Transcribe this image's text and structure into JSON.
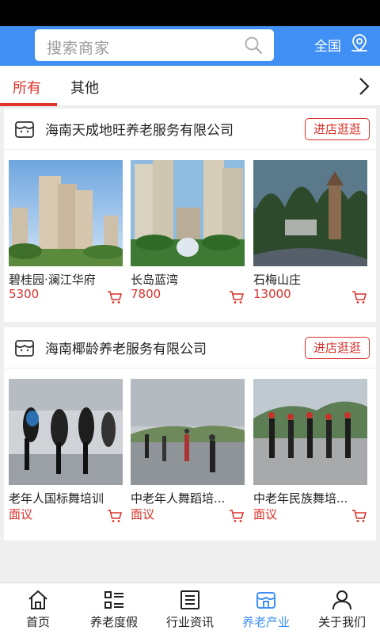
{
  "search": {
    "placeholder": "搜索商家"
  },
  "header": {
    "region": "全国"
  },
  "tabs": [
    {
      "label": "所有"
    },
    {
      "label": "其他"
    }
  ],
  "shops": [
    {
      "name": "海南天成地旺养老服务有限公司",
      "visit_label": "进店逛逛",
      "products": [
        {
          "name": "碧桂园·澜江华府",
          "price": "5300"
        },
        {
          "name": "长岛蓝湾",
          "price": "7800"
        },
        {
          "name": "石梅山庄",
          "price": "13000"
        }
      ]
    },
    {
      "name": "海南椰龄养老服务有限公司",
      "visit_label": "进店逛逛",
      "products": [
        {
          "name": "老年人国标舞培训",
          "price": "面议"
        },
        {
          "name": "中老年人舞蹈培...",
          "price": "面议"
        },
        {
          "name": "中老年民族舞培...",
          "price": "面议"
        }
      ]
    }
  ],
  "nav": [
    {
      "label": "首页",
      "icon": "home-icon"
    },
    {
      "label": "养老度假",
      "icon": "list-icon"
    },
    {
      "label": "行业资讯",
      "icon": "news-icon"
    },
    {
      "label": "养老产业",
      "icon": "store-icon",
      "active": true
    },
    {
      "label": "关于我们",
      "icon": "user-icon"
    }
  ],
  "colors": {
    "brand_blue": "#3f8ff5",
    "accent_red": "#d9302a"
  }
}
